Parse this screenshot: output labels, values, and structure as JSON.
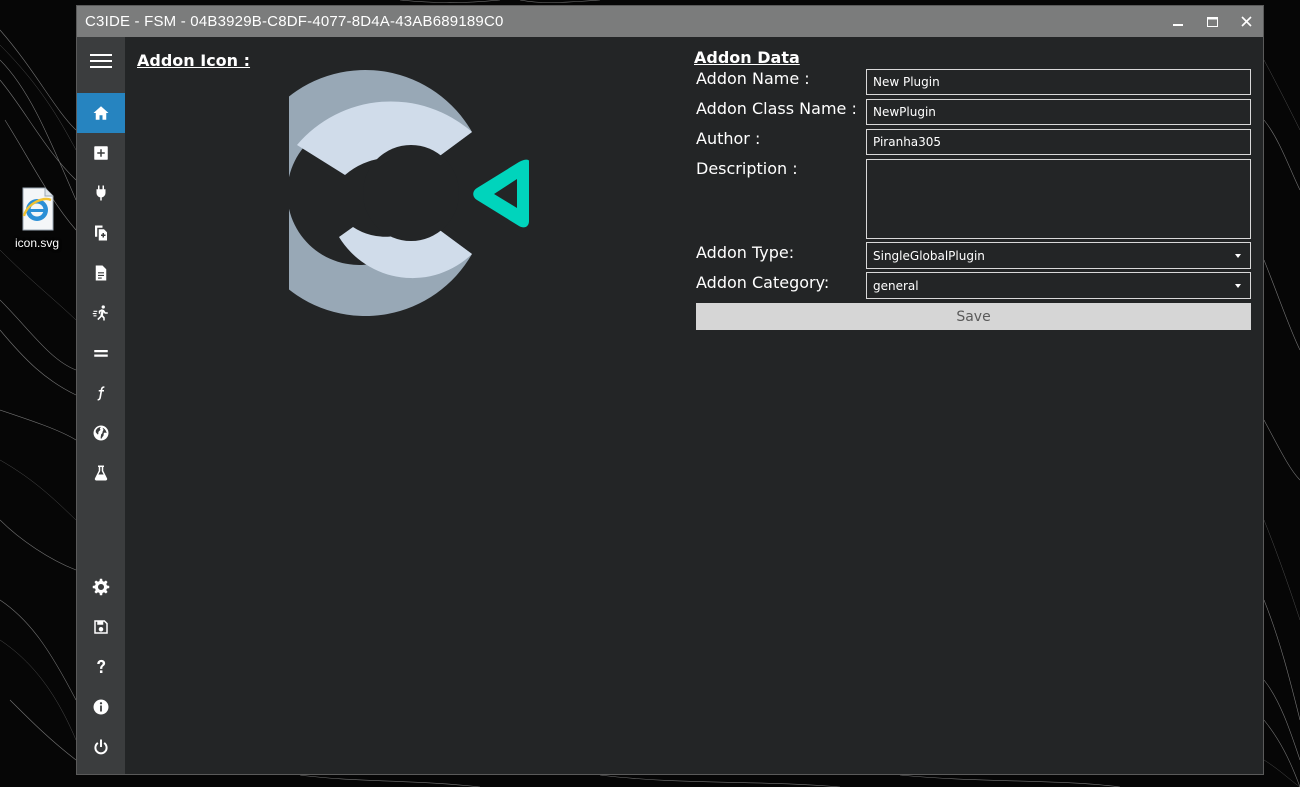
{
  "window": {
    "title": "C3IDE - FSM - 04B3929B-C8DF-4077-8D4A-43AB689189C0",
    "controls": [
      "minimize-icon",
      "maximize-icon",
      "close-icon"
    ]
  },
  "desktop": {
    "icon_label": "icon.svg"
  },
  "sidebar": {
    "items": [
      {
        "name": "menu",
        "icon": "hamburger-menu-icon"
      },
      {
        "name": "home",
        "icon": "home-icon",
        "active": true
      },
      {
        "name": "add",
        "icon": "plus-square-icon"
      },
      {
        "name": "plugin",
        "icon": "plug-icon"
      },
      {
        "name": "copy",
        "icon": "copy-icon"
      },
      {
        "name": "file",
        "icon": "document-icon"
      },
      {
        "name": "actions",
        "icon": "running-person-icon"
      },
      {
        "name": "conditions",
        "icon": "equals-icon"
      },
      {
        "name": "expressions",
        "icon": "function-icon"
      },
      {
        "name": "language",
        "icon": "globe-icon"
      },
      {
        "name": "test",
        "icon": "flask-icon"
      },
      {
        "name": "settings",
        "icon": "gear-icon"
      },
      {
        "name": "save",
        "icon": "floppy-disk-icon"
      },
      {
        "name": "help",
        "icon": "question-mark-icon"
      },
      {
        "name": "about",
        "icon": "info-icon"
      },
      {
        "name": "exit",
        "icon": "power-icon"
      }
    ]
  },
  "addon_icon": {
    "title": "Addon Icon :"
  },
  "addon_data": {
    "title": "Addon Data",
    "name_label": "Addon Name :",
    "name_value": "New Plugin",
    "class_label": "Addon Class Name :",
    "class_value": "NewPlugin",
    "author_label": "Author :",
    "author_value": "Piranha305",
    "description_label": "Description :",
    "description_value": "",
    "type_label": "Addon Type:",
    "type_value": "SingleGlobalPlugin",
    "category_label": "Addon Category:",
    "category_value": "general",
    "save_label": "Save"
  },
  "colors": {
    "accent": "#2684c0",
    "logo_light": "#d0dcea",
    "logo_dark": "#98a8b6",
    "logo_teal": "#00d4bc",
    "window_bg": "#232526",
    "titlebar": "#7b7c7c",
    "sidebar": "#3b3d3e"
  }
}
